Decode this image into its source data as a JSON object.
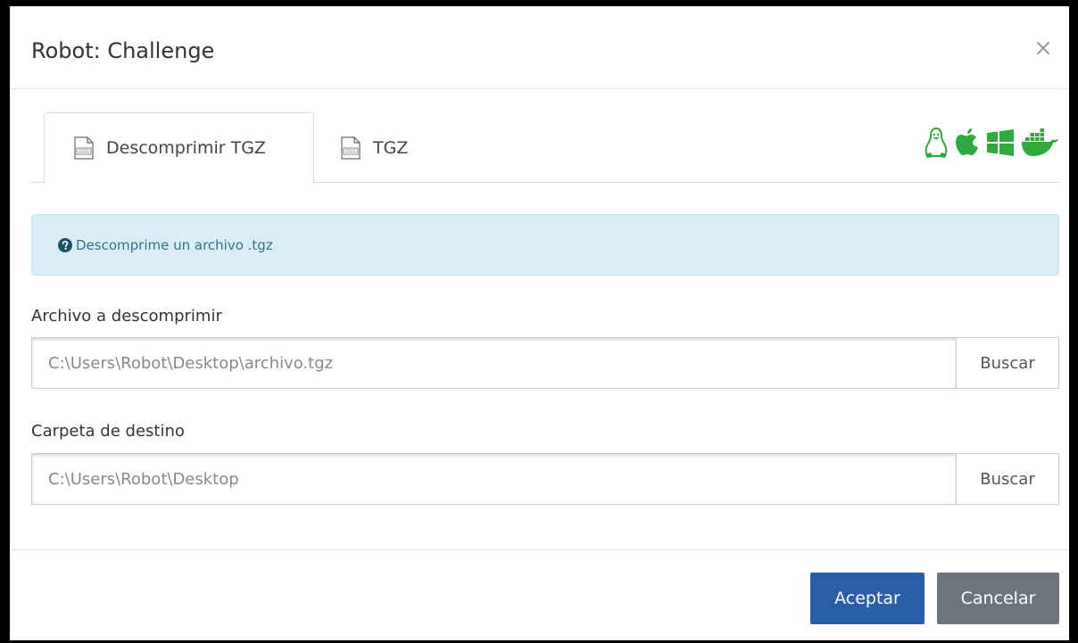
{
  "modal": {
    "title": "Robot: Challenge",
    "close_label": "×"
  },
  "tabs": [
    {
      "label": "Descomprimir TGZ",
      "icon": "tgz-file-icon",
      "active": true
    },
    {
      "label": "TGZ",
      "icon": "tgz-file-icon",
      "active": false
    }
  ],
  "os_icons": [
    "linux-icon",
    "apple-icon",
    "windows-icon",
    "docker-icon"
  ],
  "info": {
    "icon": "question-circle-icon",
    "text": "Descomprime un archivo .tgz"
  },
  "fields": {
    "source": {
      "label": "Archivo a descomprimir",
      "placeholder": "C:\\Users\\Robot\\Desktop\\archivo.tgz",
      "button": "Buscar"
    },
    "destination": {
      "label": "Carpeta de destino",
      "placeholder": "C:\\Users\\Robot\\Desktop",
      "button": "Buscar"
    }
  },
  "footer": {
    "accept_label": "Aceptar",
    "cancel_label": "Cancelar"
  },
  "colors": {
    "accent": "#2a5ea8",
    "secondary": "#6c757d",
    "os_icons": "#2eaa3c",
    "info_bg": "#d9edf7",
    "info_text": "#31708f"
  }
}
